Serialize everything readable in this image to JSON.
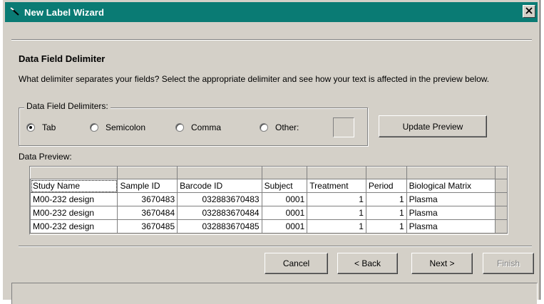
{
  "window": {
    "title": "New Label Wizard",
    "title_bar_color": "#0a7b74",
    "icon": "wizard-wand-icon",
    "close_icon": "close-icon"
  },
  "page": {
    "section_title": "Data Field Delimiter",
    "instructions": "What delimiter separates your fields?  Select the appropriate delimiter and see how your text is affected in the preview below."
  },
  "delimiters": {
    "group_label": "Data Field Delimiters:",
    "options": [
      {
        "label": "Tab",
        "checked": true
      },
      {
        "label": "Semicolon",
        "checked": false
      },
      {
        "label": "Comma",
        "checked": false
      },
      {
        "label": "Other:",
        "checked": false
      }
    ],
    "other_value": ""
  },
  "buttons": {
    "update_preview": "Update Preview",
    "cancel": "Cancel",
    "back": "< Back",
    "next": "Next >",
    "finish": "Finish"
  },
  "preview": {
    "label": "Data Preview:",
    "columns": [
      "Study Name",
      "Sample ID",
      "Barcode ID",
      "Subject",
      "Treatment",
      "Period",
      "Biological Matrix"
    ],
    "rows": [
      [
        "M00-232 design",
        "3670483",
        "032883670483",
        "0001",
        "1",
        "1",
        "Plasma"
      ],
      [
        "M00-232 design",
        "3670484",
        "032883670484",
        "0001",
        "1",
        "1",
        "Plasma"
      ],
      [
        "M00-232 design",
        "3670485",
        "032883670485",
        "0001",
        "1",
        "1",
        "Plasma"
      ]
    ]
  }
}
